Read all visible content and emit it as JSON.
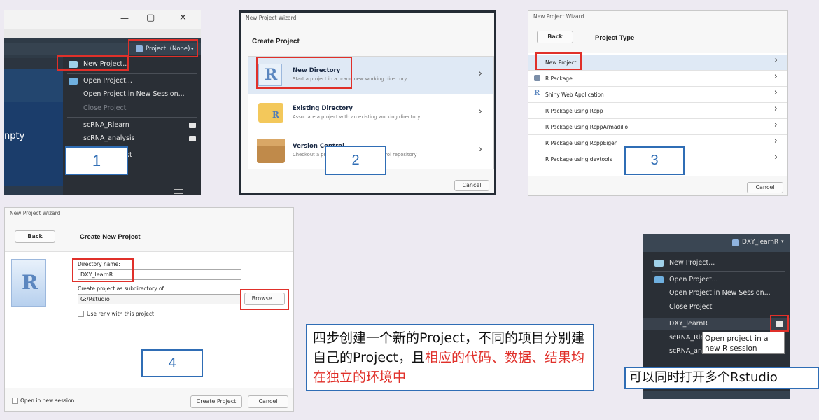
{
  "panel1": {
    "window_controls": {
      "minimize": "—",
      "restore": "▢",
      "close": "✕"
    },
    "project_button": "Project: (None)",
    "menu": {
      "new_project": "New Project...",
      "open_project": "Open Project...",
      "open_new_session": "Open Project in New Session...",
      "close_project": "Close Project",
      "recent": [
        "scRNA_Rlearn",
        "scRNA_analysis"
      ],
      "partial_item": "st"
    },
    "left_text": "npty",
    "step_label": "1"
  },
  "panel2": {
    "window_title": "New Project Wizard",
    "heading": "Create Project",
    "options": [
      {
        "title": "New Directory",
        "desc": "Start a project in a brand new working directory"
      },
      {
        "title": "Existing Directory",
        "desc": "Associate a project with an existing working directory"
      },
      {
        "title": "Version Control",
        "desc": "Checkout a project from a version control repository"
      }
    ],
    "cancel": "Cancel",
    "step_label": "2"
  },
  "panel3": {
    "window_title": "New Project Wizard",
    "back": "Back",
    "heading": "Project Type",
    "items": [
      "New Project",
      "R Package",
      "Shiny Web Application",
      "R Package using Rcpp",
      "R Package using RcppArmadillo",
      "R Package using RcppEigen",
      "R Package using devtools"
    ],
    "cancel": "Cancel",
    "step_label": "3"
  },
  "panel4": {
    "window_title": "New Project Wizard",
    "back": "Back",
    "heading": "Create New Project",
    "dir_label": "Directory name:",
    "dir_value": "DXY_learnR",
    "sub_label": "Create project as subdirectory of:",
    "sub_value": "G:/Rstudio",
    "browse": "Browse...",
    "renv": "Use renv with this project",
    "open_new_session": "Open in new session",
    "create": "Create Project",
    "cancel": "Cancel",
    "step_label": "4"
  },
  "note": {
    "black": "四步创建一个新的Project，不同的项目分别建自己的Project，且",
    "red": "相应的代码、数据、结果均在独立的环境中"
  },
  "panel5": {
    "project_button": "DXY_learnR",
    "menu": {
      "new_project": "New Project...",
      "open_project": "Open Project...",
      "open_new_session": "Open Project in New Session...",
      "close_project": "Close Project",
      "recent": [
        "DXY_learnR",
        "scRNA_Rle",
        "scRNA_ana"
      ]
    },
    "tooltip": "Open project in a new R session",
    "caption": "可以同时打开多个Rstudio"
  },
  "colors": {
    "highlight_red": "#e0302a",
    "step_blue": "#2f6db5",
    "rstudio_dark": "#2a2f36"
  }
}
